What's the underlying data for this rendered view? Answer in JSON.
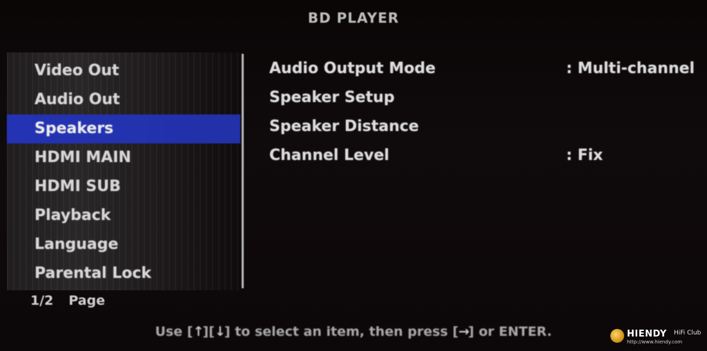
{
  "header": {
    "title": "BD PLAYER"
  },
  "sidebar": {
    "items": [
      {
        "label": "Video Out",
        "selected": false
      },
      {
        "label": "Audio Out",
        "selected": false
      },
      {
        "label": "Speakers",
        "selected": true
      },
      {
        "label": "HDMI MAIN",
        "selected": false
      },
      {
        "label": "HDMI SUB",
        "selected": false
      },
      {
        "label": "Playback",
        "selected": false
      },
      {
        "label": "Language",
        "selected": false
      },
      {
        "label": "Parental Lock",
        "selected": false
      }
    ],
    "page": {
      "current": "1/2",
      "label": "Page"
    }
  },
  "options": [
    {
      "label": "Audio Output Mode",
      "value": ": Multi-channel"
    },
    {
      "label": "Speaker Setup",
      "value": ""
    },
    {
      "label": "Speaker Distance",
      "value": ""
    },
    {
      "label": "Channel Level",
      "value": ": Fix"
    }
  ],
  "footer": {
    "hint_use": "Use [",
    "hint_mid1": "][",
    "hint_mid2": "] to select an item, then press [",
    "hint_end": "] or ENTER.",
    "key_up": "↑",
    "key_down": "↓",
    "key_right": "→"
  },
  "watermark": {
    "brand": "HIENDY",
    "club": "HiFi Club",
    "site": "http://www.hiendy.com"
  },
  "colors": {
    "selection": "#2433b4",
    "background": "#0b0709",
    "text": "#d6d6d6"
  }
}
